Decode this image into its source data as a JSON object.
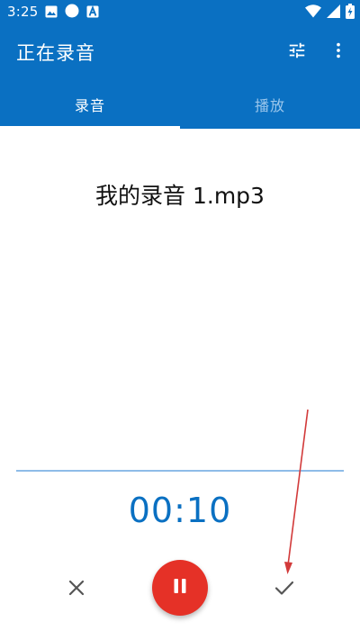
{
  "status_bar": {
    "time": "3:25",
    "left_icons": [
      "image-icon",
      "circle-icon",
      "font-icon"
    ],
    "right_icons": [
      "wifi-icon",
      "signal-icon",
      "battery-charging-icon"
    ]
  },
  "app_bar": {
    "title": "正在录音",
    "actions": [
      "tune-icon",
      "more-vert-icon"
    ]
  },
  "tabs": [
    {
      "label": "录音",
      "selected": true
    },
    {
      "label": "播放",
      "selected": false
    }
  ],
  "recording": {
    "file_name": "我的录音 1.mp3",
    "elapsed": "00:10"
  },
  "controls": {
    "cancel_icon": "close-icon",
    "pause_icon": "pause-icon",
    "confirm_icon": "check-icon"
  },
  "colors": {
    "primary": "#0a70c2",
    "accent_red": "#e53127",
    "wave_line": "#8ebce8",
    "annotation_arrow": "#d23a3a"
  }
}
